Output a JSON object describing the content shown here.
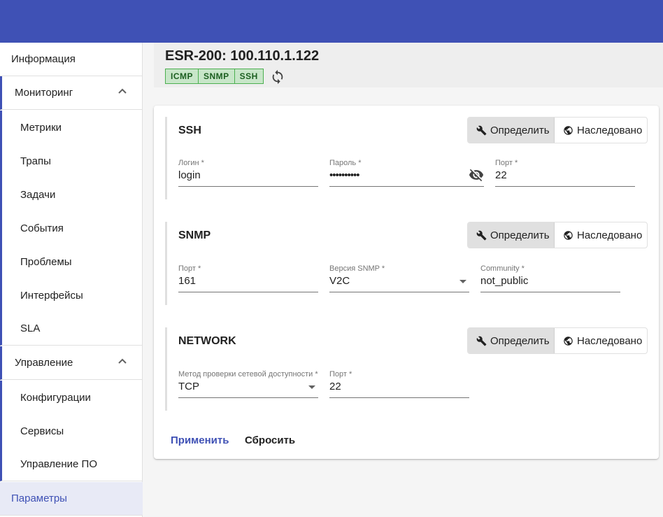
{
  "sidebar": {
    "info": "Информация",
    "monitoring": {
      "label": "Мониторинг",
      "items": [
        "Метрики",
        "Трапы",
        "Задачи",
        "События",
        "Проблемы",
        "Интерфейсы",
        "SLA"
      ]
    },
    "management": {
      "label": "Управление",
      "items": [
        "Конфигурации",
        "Сервисы",
        "Управление ПО"
      ]
    },
    "params": "Параметры"
  },
  "device": {
    "title": "ESR-200: 100.110.1.122",
    "badges": [
      "ICMP",
      "SNMP",
      "SSH"
    ]
  },
  "toggle": {
    "define": "Определить",
    "inherit": "Наследовано"
  },
  "ssh": {
    "title": "SSH",
    "login": {
      "label": "Логин *",
      "value": "login"
    },
    "password": {
      "label": "Пароль *",
      "value": "••••••••••"
    },
    "port": {
      "label": "Порт *",
      "value": "22"
    }
  },
  "snmp": {
    "title": "SNMP",
    "port": {
      "label": "Порт *",
      "value": "161"
    },
    "version": {
      "label": "Версия SNMP *",
      "value": "V2C"
    },
    "community": {
      "label": "Community *",
      "value": "not_public"
    }
  },
  "network": {
    "title": "NETWORK",
    "method": {
      "label": "Метод проверки сетевой доступности *",
      "value": "TCP"
    },
    "port": {
      "label": "Порт *",
      "value": "22"
    }
  },
  "actions": {
    "apply": "Применить",
    "reset": "Сбросить"
  },
  "colors": {
    "primary": "#3f51b5",
    "badge_bg": "#c8e6c9",
    "badge_border": "#4caf50"
  }
}
